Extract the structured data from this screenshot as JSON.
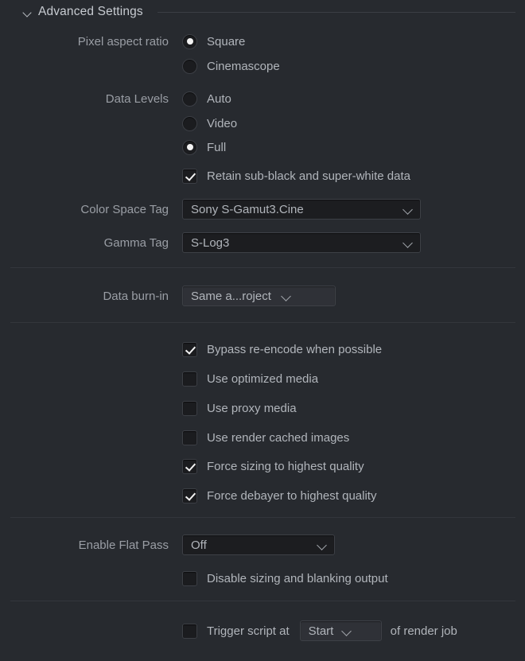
{
  "section": {
    "title": "Advanced Settings",
    "expanded": true,
    "chevron_icon": "chevron-down-icon"
  },
  "colors": {
    "panel_bg": "#272a2f",
    "label_text": "#9a9ea5",
    "value_text": "#b1b5bb",
    "control_bg": "#1c1d20",
    "control_bg_raised": "#2f3137",
    "control_border": "#3d4046",
    "divider": "#33363c",
    "check_mark": "#f2f2f2"
  },
  "rows": {
    "pixel_aspect_ratio": {
      "label": "Pixel aspect ratio",
      "options": [
        {
          "label": "Square",
          "selected": true
        },
        {
          "label": "Cinemascope",
          "selected": false
        }
      ]
    },
    "data_levels": {
      "label": "Data Levels",
      "options": [
        {
          "label": "Auto",
          "selected": false
        },
        {
          "label": "Video",
          "selected": false
        },
        {
          "label": "Full",
          "selected": true
        }
      ],
      "retain_checkbox": {
        "label": "Retain sub-black and super-white data",
        "checked": true
      }
    },
    "color_space_tag": {
      "label": "Color Space Tag",
      "value": "Sony S-Gamut3.Cine",
      "chevron_icon": "chevron-down-icon"
    },
    "gamma_tag": {
      "label": "Gamma Tag",
      "value": "S-Log3",
      "chevron_icon": "chevron-down-icon"
    },
    "data_burn_in": {
      "label": "Data burn-in",
      "value": "Same a...roject",
      "chevron_icon": "chevron-down-icon"
    },
    "quality_checkboxes": [
      {
        "label": "Bypass re-encode when possible",
        "checked": true
      },
      {
        "label": "Use optimized media",
        "checked": false
      },
      {
        "label": "Use proxy media",
        "checked": false
      },
      {
        "label": "Use render cached images",
        "checked": false
      },
      {
        "label": "Force sizing to highest quality",
        "checked": true
      },
      {
        "label": "Force debayer to highest quality",
        "checked": true
      }
    ],
    "enable_flat_pass": {
      "label": "Enable Flat Pass",
      "value": "Off",
      "chevron_icon": "chevron-down-icon"
    },
    "disable_sizing": {
      "label": "Disable sizing and blanking output",
      "checked": false
    },
    "trigger_script": {
      "checked": false,
      "text_before": "Trigger script at",
      "value": "Start",
      "text_after": "of render job",
      "chevron_icon": "chevron-down-icon"
    }
  }
}
